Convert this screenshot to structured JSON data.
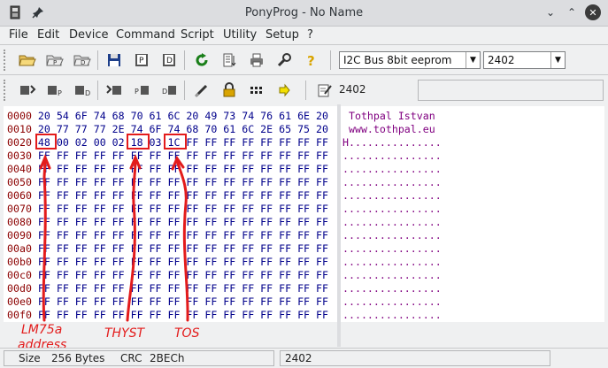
{
  "window": {
    "title": "PonyProg - No Name"
  },
  "menu": [
    "File",
    "Edit",
    "Device",
    "Command",
    "Script",
    "Utility",
    "Setup",
    "?"
  ],
  "toolbar": {
    "device_family": "I2C Bus 8bit eeprom",
    "device_type": "2402",
    "device_label": "2402"
  },
  "icons": {
    "toolbar1": [
      "open-file-icon",
      "open-program-file-icon",
      "open-data-file-icon",
      "save-icon",
      "save-program-icon",
      "save-data-icon",
      "reload-icon",
      "edit-list-icon",
      "print-icon",
      "setup-wrench-icon",
      "help-icon"
    ],
    "toolbar2": [
      "read-all-icon",
      "read-program-icon",
      "read-data-icon",
      "write-all-icon",
      "write-program-icon",
      "write-data-icon",
      "erase-icon",
      "lock-icon",
      "config-bits-icon",
      "next-arrow-icon",
      "notes-icon"
    ]
  },
  "hex": {
    "rows": [
      {
        "addr": "0000",
        "bytes": "20 54 6F 74 68 70 61 6C 20 49 73 74 76 61 6E 20",
        "ascii": " Tothpal Istvan "
      },
      {
        "addr": "0010",
        "bytes": "20 77 77 77 2E 74 6F 74 68 70 61 6C 2E 65 75 20",
        "ascii": " www.tothpal.eu "
      },
      {
        "addr": "0020",
        "bytes": "48 00 02 00 02 18 03 1C FF FF FF FF FF FF FF FF",
        "ascii": "H..............."
      },
      {
        "addr": "0030",
        "bytes": "FF FF FF FF FF FF FF FF FF FF FF FF FF FF FF FF",
        "ascii": "................"
      },
      {
        "addr": "0040",
        "bytes": "FF FF FF FF FF FF FF FF FF FF FF FF FF FF FF FF",
        "ascii": "................"
      },
      {
        "addr": "0050",
        "bytes": "FF FF FF FF FF FF FF FF FF FF FF FF FF FF FF FF",
        "ascii": "................"
      },
      {
        "addr": "0060",
        "bytes": "FF FF FF FF FF FF FF FF FF FF FF FF FF FF FF FF",
        "ascii": "................"
      },
      {
        "addr": "0070",
        "bytes": "FF FF FF FF FF FF FF FF FF FF FF FF FF FF FF FF",
        "ascii": "................"
      },
      {
        "addr": "0080",
        "bytes": "FF FF FF FF FF FF FF FF FF FF FF FF FF FF FF FF",
        "ascii": "................"
      },
      {
        "addr": "0090",
        "bytes": "FF FF FF FF FF FF FF FF FF FF FF FF FF FF FF FF",
        "ascii": "................"
      },
      {
        "addr": "00a0",
        "bytes": "FF FF FF FF FF FF FF FF FF FF FF FF FF FF FF FF",
        "ascii": "................"
      },
      {
        "addr": "00b0",
        "bytes": "FF FF FF FF FF FF FF FF FF FF FF FF FF FF FF FF",
        "ascii": "................"
      },
      {
        "addr": "00c0",
        "bytes": "FF FF FF FF FF FF FF FF FF FF FF FF FF FF FF FF",
        "ascii": "................"
      },
      {
        "addr": "00d0",
        "bytes": "FF FF FF FF FF FF FF FF FF FF FF FF FF FF FF FF",
        "ascii": "................"
      },
      {
        "addr": "00e0",
        "bytes": "FF FF FF FF FF FF FF FF FF FF FF FF FF FF FF FF",
        "ascii": "................"
      },
      {
        "addr": "00f0",
        "bytes": "FF FF FF FF FF FF FF FF FF FF FF FF FF FF FF FF",
        "ascii": "................"
      }
    ]
  },
  "annotations": {
    "address_line1": "LM75a",
    "address_line2": "address",
    "thyst": "THYST",
    "tos": "TOS",
    "color": "#e31b1b"
  },
  "status": {
    "size_label": "Size",
    "size_value": "256 Bytes",
    "crc_label": "CRC",
    "crc_value": "2BECh",
    "device": "2402"
  },
  "colors": {
    "address": "#8b0000",
    "bytes": "#00008b",
    "ascii": "#800080"
  }
}
